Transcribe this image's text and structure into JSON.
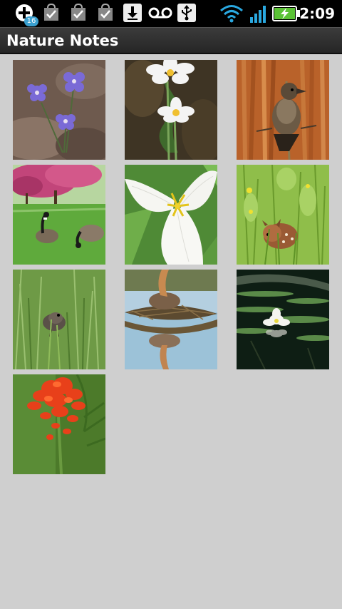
{
  "status_bar": {
    "time": "2:09",
    "notification_count": "16",
    "icons": [
      "add-notification-icon",
      "market-update-icon",
      "market-update-icon",
      "market-update-icon",
      "download-icon",
      "voicemail-icon",
      "usb-icon",
      "wifi-icon",
      "signal-icon",
      "battery-charging-icon"
    ]
  },
  "header": {
    "title": "Nature Notes"
  },
  "gallery": {
    "photos": [
      {
        "subject": "purple hepatica flowers"
      },
      {
        "subject": "white bloodroot flowers"
      },
      {
        "subject": "female red-winged blackbird on reeds"
      },
      {
        "subject": "canada geese under blossoming tree"
      },
      {
        "subject": "white trillium flower"
      },
      {
        "subject": "fawn hidden in grass"
      },
      {
        "subject": "fledgling bird in grass"
      },
      {
        "subject": "grebe on floating nest"
      },
      {
        "subject": "white water lily"
      },
      {
        "subject": "indian paintbrush flower"
      }
    ]
  }
}
